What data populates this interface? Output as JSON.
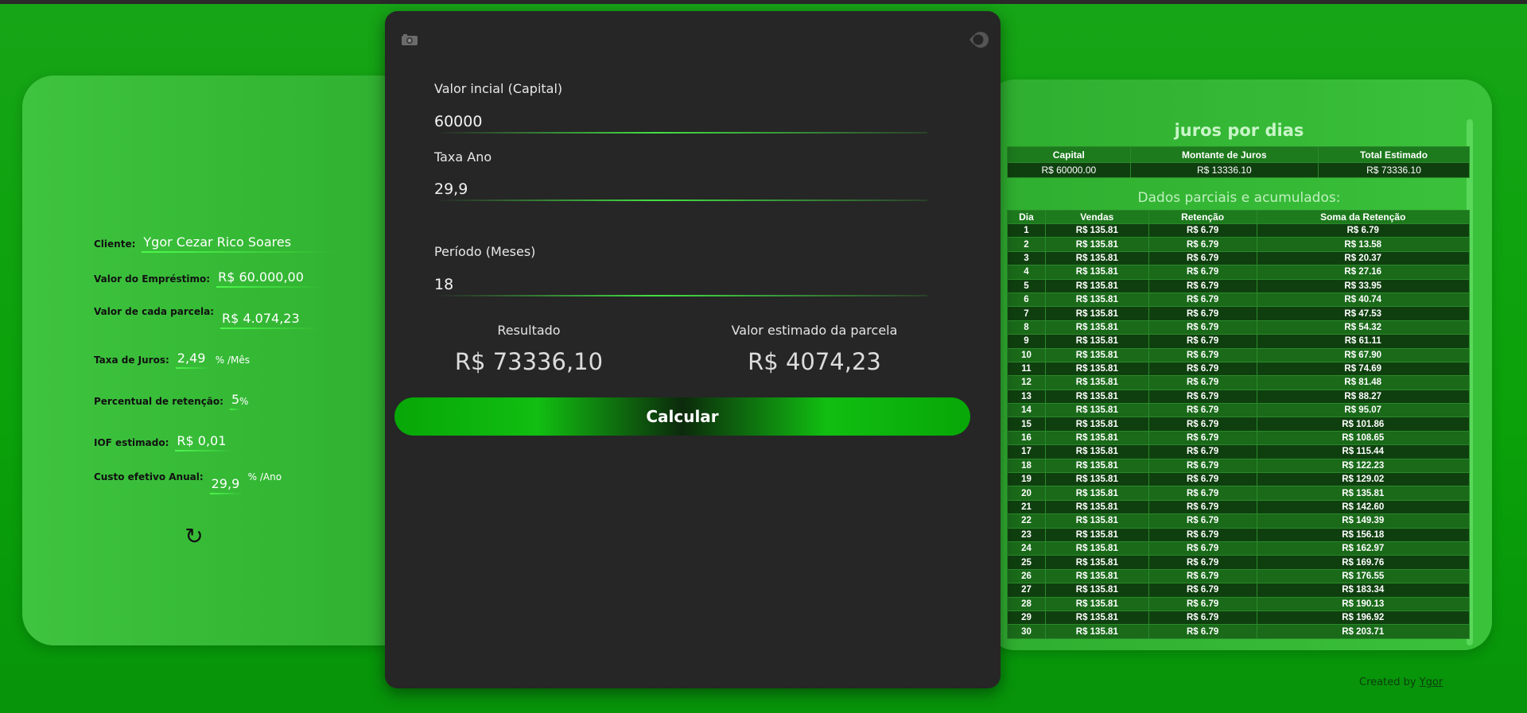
{
  "left": {
    "cliente_label": "Cliente:",
    "cliente_value": "Ygor Cezar Rico Soares",
    "emprestimo_label": "Valor do Empréstimo:",
    "emprestimo_value": "R$ 60.000,00",
    "parcela_label": "Valor de cada parcela:",
    "parcela_value": "R$ 4.074,23",
    "taxa_label": "Taxa de Juros:",
    "taxa_value": "2,49",
    "taxa_unit": "% /Mês",
    "retencao_label": "Percentual de retenção:",
    "retencao_value": "5",
    "retencao_unit": "%",
    "iof_label": "IOF estimado:",
    "iof_value": "R$ 0,01",
    "cea_label": "Custo efetivo Anual:",
    "cea_value": "29,9",
    "cea_unit": "% /Ano",
    "refresh_icon": "refresh-icon"
  },
  "form": {
    "capital_label": "Valor incial (Capital)",
    "capital_value": "60000",
    "taxa_ano_label": "Taxa Ano",
    "taxa_ano_value": "29,9",
    "periodo_label": "Período (Meses)",
    "periodo_value": "18",
    "resultado_label": "Resultado",
    "resultado_value": "R$ 73336,10",
    "parcela_label": "Valor estimado da parcela",
    "parcela_value": "R$ 4074,23",
    "calc_button": "Calcular"
  },
  "right": {
    "title": "juros por dias",
    "summary_headers": [
      "Capital",
      "Montante de Juros",
      "Total Estimado"
    ],
    "summary_values": [
      "R$ 60000.00",
      "R$ 13336.10",
      "R$ 73336.10"
    ],
    "daily_title": "Dados parciais e acumulados:",
    "daily_headers": [
      "Dia",
      "Vendas",
      "Retenção",
      "Soma da Retenção"
    ],
    "daily_rows": [
      [
        "1",
        "R$ 135.81",
        "R$ 6.79",
        "R$ 6.79"
      ],
      [
        "2",
        "R$ 135.81",
        "R$ 6.79",
        "R$ 13.58"
      ],
      [
        "3",
        "R$ 135.81",
        "R$ 6.79",
        "R$ 20.37"
      ],
      [
        "4",
        "R$ 135.81",
        "R$ 6.79",
        "R$ 27.16"
      ],
      [
        "5",
        "R$ 135.81",
        "R$ 6.79",
        "R$ 33.95"
      ],
      [
        "6",
        "R$ 135.81",
        "R$ 6.79",
        "R$ 40.74"
      ],
      [
        "7",
        "R$ 135.81",
        "R$ 6.79",
        "R$ 47.53"
      ],
      [
        "8",
        "R$ 135.81",
        "R$ 6.79",
        "R$ 54.32"
      ],
      [
        "9",
        "R$ 135.81",
        "R$ 6.79",
        "R$ 61.11"
      ],
      [
        "10",
        "R$ 135.81",
        "R$ 6.79",
        "R$ 67.90"
      ],
      [
        "11",
        "R$ 135.81",
        "R$ 6.79",
        "R$ 74.69"
      ],
      [
        "12",
        "R$ 135.81",
        "R$ 6.79",
        "R$ 81.48"
      ],
      [
        "13",
        "R$ 135.81",
        "R$ 6.79",
        "R$ 88.27"
      ],
      [
        "14",
        "R$ 135.81",
        "R$ 6.79",
        "R$ 95.07"
      ],
      [
        "15",
        "R$ 135.81",
        "R$ 6.79",
        "R$ 101.86"
      ],
      [
        "16",
        "R$ 135.81",
        "R$ 6.79",
        "R$ 108.65"
      ],
      [
        "17",
        "R$ 135.81",
        "R$ 6.79",
        "R$ 115.44"
      ],
      [
        "18",
        "R$ 135.81",
        "R$ 6.79",
        "R$ 122.23"
      ],
      [
        "19",
        "R$ 135.81",
        "R$ 6.79",
        "R$ 129.02"
      ],
      [
        "20",
        "R$ 135.81",
        "R$ 6.79",
        "R$ 135.81"
      ],
      [
        "21",
        "R$ 135.81",
        "R$ 6.79",
        "R$ 142.60"
      ],
      [
        "22",
        "R$ 135.81",
        "R$ 6.79",
        "R$ 149.39"
      ],
      [
        "23",
        "R$ 135.81",
        "R$ 6.79",
        "R$ 156.18"
      ],
      [
        "24",
        "R$ 135.81",
        "R$ 6.79",
        "R$ 162.97"
      ],
      [
        "25",
        "R$ 135.81",
        "R$ 6.79",
        "R$ 169.76"
      ],
      [
        "26",
        "R$ 135.81",
        "R$ 6.79",
        "R$ 176.55"
      ],
      [
        "27",
        "R$ 135.81",
        "R$ 6.79",
        "R$ 183.34"
      ],
      [
        "28",
        "R$ 135.81",
        "R$ 6.79",
        "R$ 190.13"
      ],
      [
        "29",
        "R$ 135.81",
        "R$ 6.79",
        "R$ 196.92"
      ],
      [
        "30",
        "R$ 135.81",
        "R$ 6.79",
        "R$ 203.71"
      ]
    ]
  },
  "footer": {
    "prefix": "Created by",
    "link": "Ygor"
  },
  "colors": {
    "background": "#0aa10a",
    "card": "#262626",
    "accent": "#11be11"
  }
}
